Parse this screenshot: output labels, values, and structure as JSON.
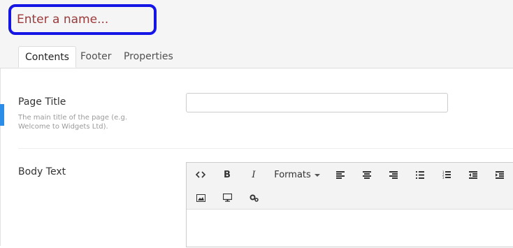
{
  "header": {
    "name_placeholder": "Enter a name..."
  },
  "tabs": [
    {
      "label": "Contents",
      "active": true
    },
    {
      "label": "Footer",
      "active": false
    },
    {
      "label": "Properties",
      "active": false
    }
  ],
  "fields": {
    "page_title": {
      "label": "Page Title",
      "description": "The main title of the page (e.g. Welcome to Widgets Ltd).",
      "value": ""
    },
    "body_text": {
      "label": "Body Text"
    }
  },
  "editor": {
    "toolbar_row1": [
      "code-icon",
      "bold-icon",
      "italic-icon",
      "formats-dropdown",
      "align-left-icon",
      "align-center-icon",
      "align-right-icon",
      "bullet-list-icon",
      "numbered-list-icon",
      "outdent-icon",
      "indent-icon"
    ],
    "toolbar_row2": [
      "image-icon",
      "media-icon",
      "macro-icon"
    ],
    "formats_label": "Formats"
  },
  "colors": {
    "highlight_border": "#1515e6",
    "accent_marker": "#2b8de8",
    "placeholder_text": "#9a3a3a"
  }
}
